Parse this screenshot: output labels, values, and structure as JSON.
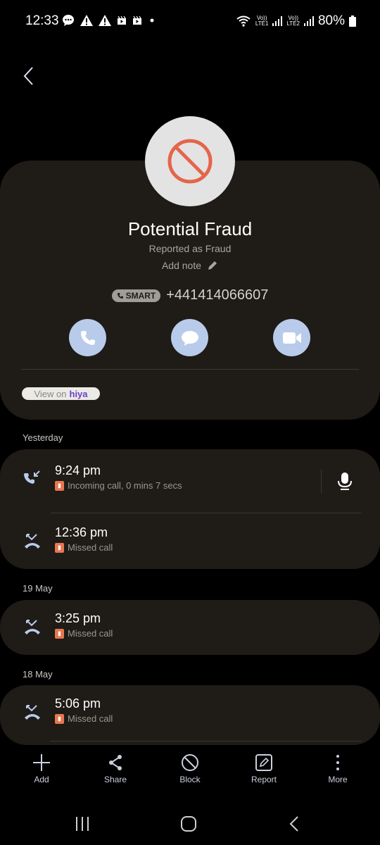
{
  "status_bar": {
    "time": "12:33",
    "left_icons": [
      "message-icon",
      "warning-icon",
      "warning-icon",
      "media-icon",
      "media-icon",
      "dot-icon"
    ],
    "sim1_label_top": "Vo))",
    "sim1_label_bottom": "LTE1",
    "sim2_label_top": "Vo))",
    "sim2_label_bottom": "LTE2",
    "battery": "80%"
  },
  "contact": {
    "name": "Potential Fraud",
    "subtitle": "Reported as Fraud",
    "add_note": "Add note",
    "badge": "SMART",
    "number": "+441414066607",
    "hiya_prefix": "View on",
    "hiya_brand": "hiya",
    "actions": [
      "call",
      "message",
      "video-call"
    ]
  },
  "colors": {
    "card_bg": "#1f1b17",
    "action_bg": "#b8cbea",
    "fraud_red": "#e5654a",
    "sim_orange": "#e8764e"
  },
  "call_log": [
    {
      "date": "Yesterday",
      "entries": [
        {
          "time": "9:24 pm",
          "type": "incoming",
          "description": "Incoming call, 0 mins 7 secs",
          "has_recording": true
        },
        {
          "time": "12:36 pm",
          "type": "missed",
          "description": "Missed call",
          "has_recording": false
        }
      ]
    },
    {
      "date": "19 May",
      "entries": [
        {
          "time": "3:25 pm",
          "type": "missed",
          "description": "Missed call",
          "has_recording": false
        }
      ]
    },
    {
      "date": "18 May",
      "entries": [
        {
          "time": "5:06 pm",
          "type": "missed",
          "description": "Missed call",
          "has_recording": false
        }
      ]
    }
  ],
  "bottom_actions": {
    "add": "Add",
    "share": "Share",
    "block": "Block",
    "report": "Report",
    "more": "More"
  }
}
